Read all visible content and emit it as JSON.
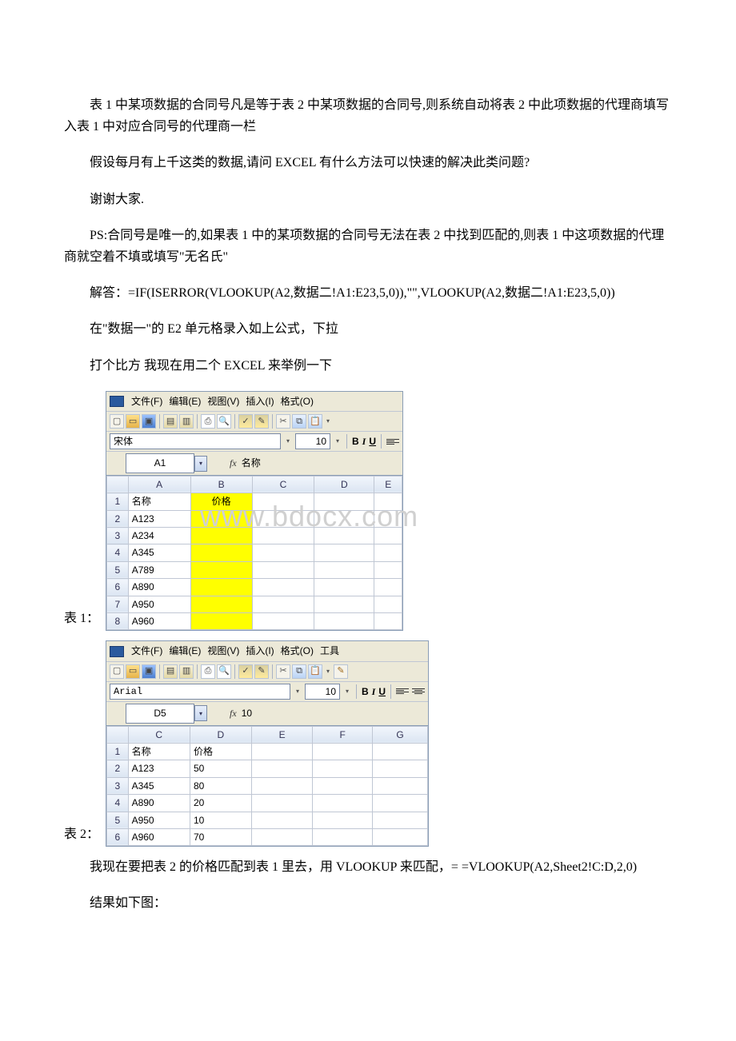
{
  "paragraphs": {
    "p1": "表 1 中某项数据的合同号凡是等于表 2 中某项数据的合同号,则系统自动将表 2 中此项数据的代理商填写入表 1 中对应合同号的代理商一栏",
    "p2": "假设每月有上千这类的数据,请问 EXCEL 有什么方法可以快速的解决此类问题?",
    "p3": "谢谢大家.",
    "p4": "PS:合同号是唯一的,如果表 1 中的某项数据的合同号无法在表 2 中找到匹配的,则表 1 中这项数据的代理商就空着不填或填写\"无名氏\"",
    "p5": "解答：=IF(ISERROR(VLOOKUP(A2,数据二!A1:E23,5,0)),\"\",VLOOKUP(A2,数据二!A1:E23,5,0))",
    "p6": "在\"数据一\"的 E2 单元格录入如上公式，下拉",
    "p7": "打个比方 我现在用二个 EXCEL 来举例一下",
    "p8": "我现在要把表 2 的价格匹配到表 1 里去，用 VLOOKUP 来匹配，= =VLOOKUP(A2,Sheet2!C:D,2,0)",
    "p9": "结果如下图："
  },
  "labels": {
    "table1": "表 1：",
    "table2": "表 2："
  },
  "watermark": "www.bdocx.com",
  "menus": {
    "file": "文件(F)",
    "edit": "编辑(E)",
    "view": "视图(V)",
    "insert": "插入(I)",
    "format": "格式(O)",
    "tools": "工具"
  },
  "excel1": {
    "font_name": "宋体",
    "font_size": "10",
    "name_box": "A1",
    "fx_value": "名称",
    "col_headers": [
      "A",
      "B",
      "C",
      "D",
      "E"
    ],
    "header_row": {
      "A": "名称",
      "B": "价格"
    },
    "rows": [
      {
        "n": "1",
        "A": "名称",
        "B": "价格"
      },
      {
        "n": "2",
        "A": "A123",
        "B": ""
      },
      {
        "n": "3",
        "A": "A234",
        "B": ""
      },
      {
        "n": "4",
        "A": "A345",
        "B": ""
      },
      {
        "n": "5",
        "A": "A789",
        "B": ""
      },
      {
        "n": "6",
        "A": "A890",
        "B": ""
      },
      {
        "n": "7",
        "A": "A950",
        "B": ""
      },
      {
        "n": "8",
        "A": "A960",
        "B": ""
      }
    ]
  },
  "excel2": {
    "font_name": "Arial",
    "font_size": "10",
    "name_box": "D5",
    "fx_value": "10",
    "col_headers": [
      "C",
      "D",
      "E",
      "F",
      "G"
    ],
    "rows": [
      {
        "n": "1",
        "C": "名称",
        "D": "价格",
        "E": "",
        "F": "",
        "G": ""
      },
      {
        "n": "2",
        "C": "A123",
        "D": "50",
        "E": "",
        "F": "",
        "G": ""
      },
      {
        "n": "3",
        "C": "A345",
        "D": "80",
        "E": "",
        "F": "",
        "G": ""
      },
      {
        "n": "4",
        "C": "A890",
        "D": "20",
        "E": "",
        "F": "",
        "G": ""
      },
      {
        "n": "5",
        "C": "A950",
        "D": "10",
        "E": "",
        "F": "",
        "G": ""
      },
      {
        "n": "6",
        "C": "A960",
        "D": "70",
        "E": "",
        "F": "",
        "G": ""
      }
    ]
  },
  "fmt": {
    "B": "B",
    "I": "I",
    "U": "U"
  }
}
